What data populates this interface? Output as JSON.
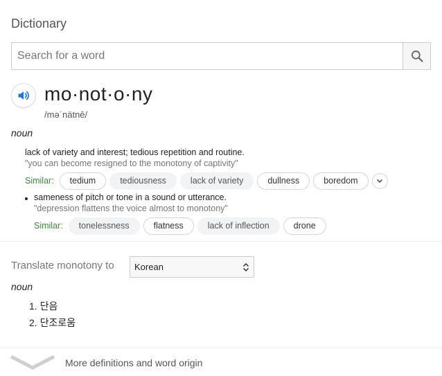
{
  "header": {
    "title": "Dictionary"
  },
  "search": {
    "placeholder": "Search for a word",
    "icon": "search-icon"
  },
  "entry": {
    "word": "mo·not·o·ny",
    "phonetic": "/məˈnätnē/",
    "part_of_speech": "noun",
    "senses": [
      {
        "definition": "lack of variety and interest; tedious repetition and routine.",
        "example": "\"you can become resigned to the monotony of captivity\"",
        "similar_label": "Similar:",
        "similar": [
          "tedium",
          "tediousness",
          "lack of variety",
          "dullness",
          "boredom"
        ]
      },
      {
        "definition": "sameness of pitch or tone in a sound or utterance.",
        "example": "\"depression flattens the voice almost to monotony\"",
        "similar_label": "Similar:",
        "similar": [
          "tonelessness",
          "flatness",
          "lack of inflection",
          "drone"
        ]
      }
    ]
  },
  "translate": {
    "label": "Translate monotony to",
    "language": "Korean",
    "part_of_speech": "noun",
    "items": [
      "1. 단음",
      "2. 단조로움"
    ]
  },
  "footer": {
    "more_label": "More definitions and word origin"
  },
  "colors": {
    "similar_label": "#3c8a3c",
    "speaker_icon": "#1a73e8"
  }
}
